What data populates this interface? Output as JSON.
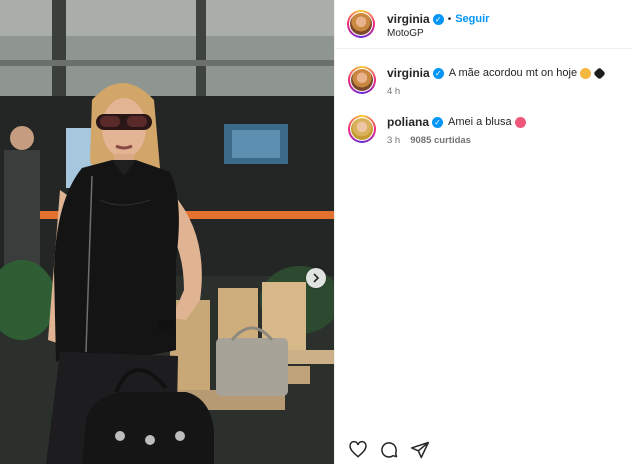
{
  "post": {
    "author": "virginia",
    "follow_label": "Seguir",
    "separator": "•",
    "location": "MotoGP"
  },
  "comments": [
    {
      "username": "virginia",
      "text": "A mãe acordou mt on hoje",
      "emojis": [
        "smiling-face-icon",
        "black-heart-icon"
      ],
      "time": "4 h",
      "likes": ""
    },
    {
      "username": "poliana",
      "text": "Amei a blusa",
      "emojis": [
        "heart-eyes-face-icon"
      ],
      "time": "3 h",
      "likes": "9085 curtidas"
    }
  ],
  "icons": {
    "verified": "verified-badge-icon",
    "next": "chevron-right-icon",
    "like": "heart-outline-icon",
    "comment": "comment-bubble-icon",
    "share": "paper-plane-icon"
  },
  "colors": {
    "accent_blue": "#0095f6",
    "text": "#262626",
    "muted": "#737373"
  }
}
